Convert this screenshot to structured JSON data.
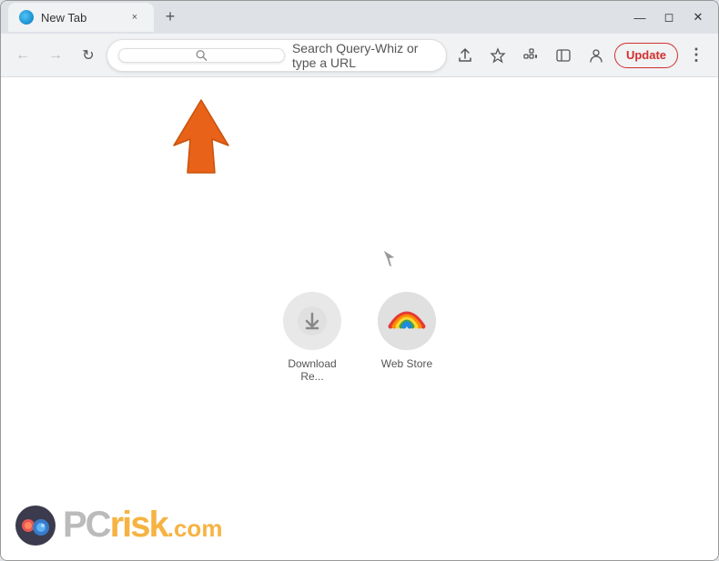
{
  "window": {
    "title": "New Tab"
  },
  "tab": {
    "label": "New Tab",
    "close_label": "×"
  },
  "new_tab_button": "+",
  "nav": {
    "back_label": "←",
    "forward_label": "→",
    "reload_label": "↻"
  },
  "address_bar": {
    "placeholder": "Search Query-Whiz or type a URL"
  },
  "toolbar_actions": {
    "share_label": "⬆",
    "bookmark_label": "☆",
    "extensions_label": "🧩",
    "sidebar_label": "▭",
    "profile_label": "👤",
    "update_label": "Update",
    "menu_label": "⋮"
  },
  "shortcuts": [
    {
      "id": "download-re",
      "label": "Download Re...",
      "icon_type": "download"
    },
    {
      "id": "web-store",
      "label": "Web Store",
      "icon_type": "webstore"
    }
  ],
  "watermark": {
    "text_pc": "PC",
    "text_risk": "risk",
    "text_dotcom": ".com"
  },
  "colors": {
    "arrow_orange": "#e8621a",
    "update_red": "#d32f2f",
    "accent_orange": "#f5a623"
  }
}
